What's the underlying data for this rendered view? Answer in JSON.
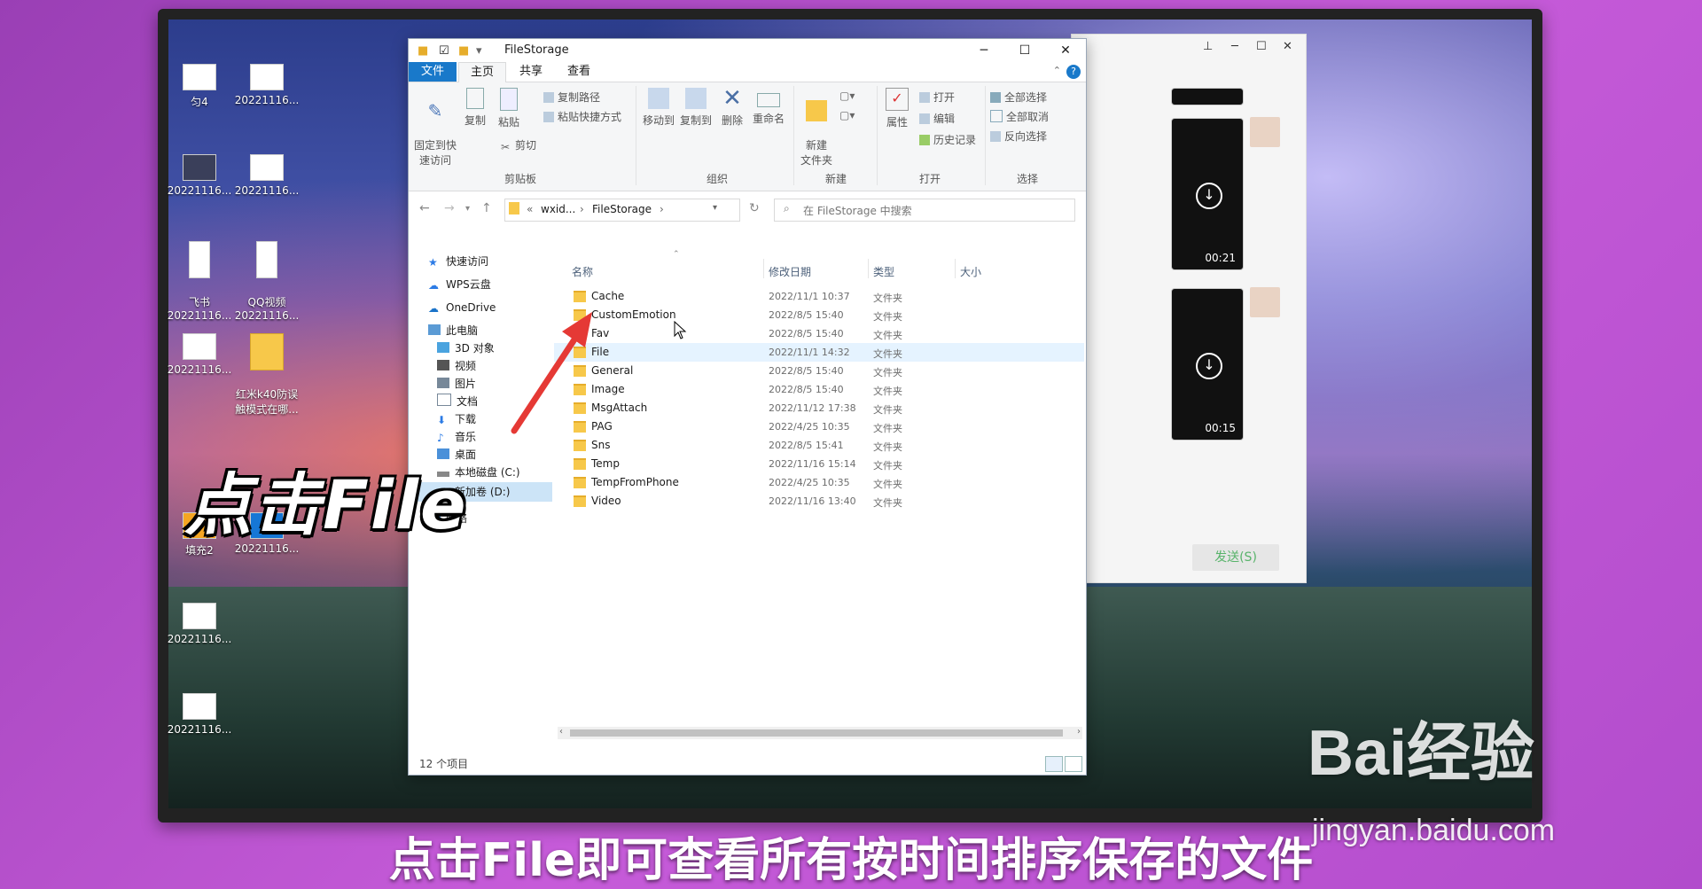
{
  "desktop": {
    "icons": [
      {
        "label": "匀4"
      },
      {
        "label": "20221116..."
      },
      {
        "label": "20221116..."
      },
      {
        "label": "20221116..."
      },
      {
        "label": "飞书\n20221116..."
      },
      {
        "label": "QQ视频\n20221116..."
      },
      {
        "label": "20221116..."
      },
      {
        "label": "红米k40防误\n触模式在哪..."
      },
      {
        "label": "填充2"
      },
      {
        "label": "20221116..."
      },
      {
        "label": "20221116..."
      },
      {
        "label": "20221116..."
      }
    ]
  },
  "chat": {
    "videos": [
      {
        "duration": "00:21"
      },
      {
        "duration": "00:15"
      }
    ],
    "send_label": "发送(S)"
  },
  "explorer": {
    "title": "FileStorage",
    "window_controls": {
      "minimize": "─",
      "maximize": "☐",
      "close": "✕"
    },
    "tabs": [
      "文件",
      "主页",
      "共享",
      "查看"
    ],
    "ribbon": {
      "clipboard": {
        "pin": "固定到快\n速访问",
        "copy": "复制",
        "paste": "粘贴",
        "copy_path": "复制路径",
        "paste_shortcut": "粘贴快捷方式",
        "cut": "剪切",
        "label": "剪贴板"
      },
      "organize": {
        "move_to": "移动到",
        "copy_to": "复制到",
        "delete": "删除",
        "rename": "重命名",
        "label": "组织"
      },
      "new": {
        "new_folder": "新建\n文件夹",
        "label": "新建"
      },
      "open": {
        "properties": "属性",
        "open": "打开",
        "edit": "编辑",
        "history": "历史记录",
        "label": "打开"
      },
      "select": {
        "select_all": "全部选择",
        "select_none": "全部取消",
        "invert": "反向选择",
        "label": "选择"
      }
    },
    "address": {
      "prefix": "«",
      "parent": "wxid...",
      "current": "FileStorage"
    },
    "search_placeholder": "在 FileStorage 中搜索",
    "nav": [
      {
        "label": "快速访问",
        "icon": "star-icon"
      },
      {
        "label": "WPS云盘",
        "icon": "cloud-icon"
      },
      {
        "label": "OneDrive",
        "icon": "onedrive-icon"
      },
      {
        "label": "此电脑",
        "icon": "computer-icon"
      },
      {
        "label": "3D 对象",
        "icon": "cube-icon"
      },
      {
        "label": "视频",
        "icon": "video-icon"
      },
      {
        "label": "图片",
        "icon": "picture-icon"
      },
      {
        "label": "文档",
        "icon": "document-icon"
      },
      {
        "label": "下载",
        "icon": "download-icon"
      },
      {
        "label": "音乐",
        "icon": "music-icon"
      },
      {
        "label": "桌面",
        "icon": "desktop-icon"
      },
      {
        "label": "本地磁盘 (C:)",
        "icon": "drive-icon"
      },
      {
        "label": "新加卷 (D:)",
        "icon": "drive-icon"
      },
      {
        "label": "网络",
        "icon": "network-icon"
      }
    ],
    "columns": {
      "name": "名称",
      "date": "修改日期",
      "type": "类型",
      "size": "大小"
    },
    "files": [
      {
        "name": "Cache",
        "date": "2022/11/1 10:37",
        "type": "文件夹"
      },
      {
        "name": "CustomEmotion",
        "date": "2022/8/5 15:40",
        "type": "文件夹"
      },
      {
        "name": "Fav",
        "date": "2022/8/5 15:40",
        "type": "文件夹"
      },
      {
        "name": "File",
        "date": "2022/11/1 14:32",
        "type": "文件夹"
      },
      {
        "name": "General",
        "date": "2022/8/5 15:40",
        "type": "文件夹"
      },
      {
        "name": "Image",
        "date": "2022/8/5 15:40",
        "type": "文件夹"
      },
      {
        "name": "MsgAttach",
        "date": "2022/11/12 17:38",
        "type": "文件夹"
      },
      {
        "name": "PAG",
        "date": "2022/4/25 10:35",
        "type": "文件夹"
      },
      {
        "name": "Sns",
        "date": "2022/8/5 15:41",
        "type": "文件夹"
      },
      {
        "name": "Temp",
        "date": "2022/11/16 15:14",
        "type": "文件夹"
      },
      {
        "name": "TempFromPhone",
        "date": "2022/4/25 10:35",
        "type": "文件夹"
      },
      {
        "name": "Video",
        "date": "2022/11/16 13:40",
        "type": "文件夹"
      }
    ],
    "status": "12 个项目"
  },
  "overlay": {
    "annotation": "点击File",
    "caption": "点击File即可查看所有按时间排序保存的文件",
    "watermark": "Bai经验",
    "watermark_url": "jingyan.baidu.com"
  }
}
